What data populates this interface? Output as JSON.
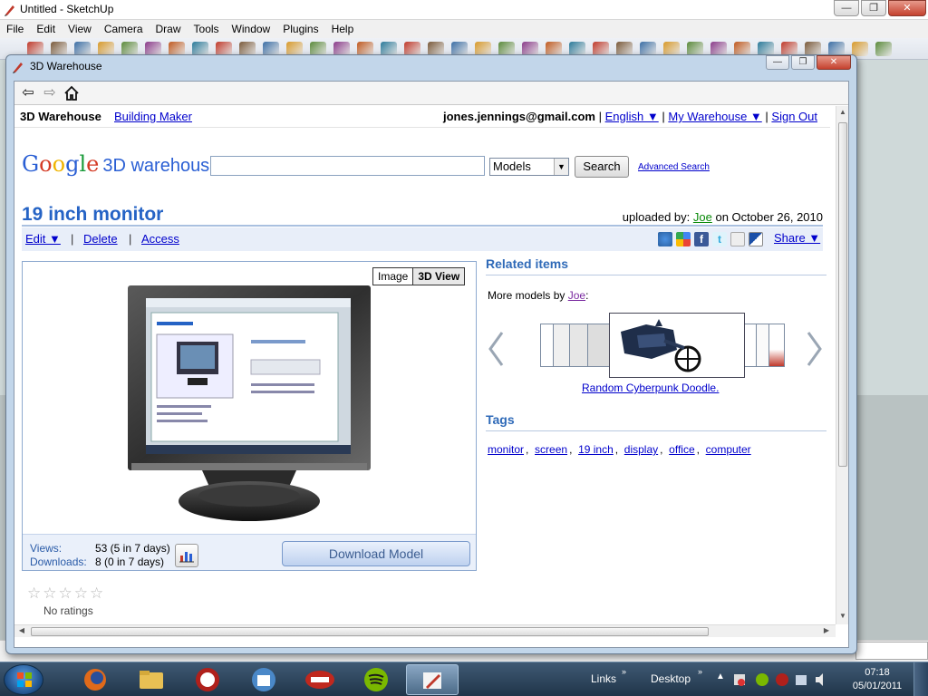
{
  "app": {
    "title": "Untitled - SketchUp",
    "menus": [
      "File",
      "Edit",
      "View",
      "Camera",
      "Draw",
      "Tools",
      "Window",
      "Plugins",
      "Help"
    ]
  },
  "toolbar": {
    "icon_names": [
      "select-icon",
      "make-component-icon",
      "paint-bucket-icon",
      "eraser-icon",
      "rectangle-icon",
      "line-icon",
      "circle-icon",
      "arc-icon",
      "polygon-icon",
      "freehand-icon",
      "move-icon",
      "push-pull-icon",
      "rotate-icon",
      "follow-me-icon",
      "scale-icon",
      "offset-icon",
      "tape-measure-icon",
      "dimension-icon",
      "protractor-icon",
      "text-icon",
      "axes-icon",
      "3d-text-icon",
      "orbit-icon",
      "pan-icon",
      "zoom-icon",
      "zoom-window-icon",
      "zoom-extents-icon",
      "previous-view-icon",
      "next-view-icon",
      "position-camera-icon",
      "walk-icon",
      "look-around-icon",
      "section-plane-icon",
      "get-models-icon",
      "share-model-icon",
      "share-component-icon",
      "google-earth-icon"
    ]
  },
  "dialog": {
    "title": "3D Warehouse",
    "nav": {
      "back": "back-arrow-icon",
      "forward": "forward-arrow-icon",
      "home": "home-icon"
    }
  },
  "warehouse": {
    "brand": "3D Warehouse",
    "building_maker": "Building Maker",
    "user_email": "jones.jennings@gmail.com",
    "language": "English ▼",
    "my_warehouse": "My Warehouse ▼",
    "sign_out": "Sign Out",
    "logo_text": "Google",
    "logo_suffix": "3D warehouse",
    "search_value": "",
    "search_scope": "Models",
    "search_button": "Search",
    "advanced_search": "Advanced Search"
  },
  "model": {
    "title": "19 inch monitor",
    "uploaded_prefix": "uploaded by:",
    "uploader": "Joe",
    "uploaded_on": "on October 26, 2010",
    "actions": {
      "edit": "Edit ▼",
      "delete": "Delete",
      "access": "Access"
    },
    "share": "Share ▼",
    "view_tabs": [
      "Image",
      "3D View"
    ],
    "active_tab": "3D View",
    "views_label": "Views:",
    "views_value": "53 (5 in 7 days)",
    "downloads_label": "Downloads:",
    "downloads_value": "8 (0 in 7 days)",
    "download_button": "Download Model"
  },
  "rating": {
    "stars": 0,
    "max_stars": 5,
    "text": "No ratings"
  },
  "related": {
    "heading": "Related items",
    "more_prefix": "More models by",
    "more_user": "Joe",
    "featured_label": "Random Cyberpunk Doodle."
  },
  "tags": {
    "heading": "Tags",
    "items": [
      "monitor",
      "screen",
      "19 inch",
      "display",
      "office",
      "computer"
    ]
  },
  "taskbar": {
    "links": "Links",
    "desktop": "Desktop",
    "time": "07:18",
    "date": "05/01/2011"
  },
  "colors": {
    "link_blue": "#0000cc",
    "title_blue": "#2563c5",
    "uploader_green": "#0a8a0a",
    "section_blue": "#2f6ab8"
  }
}
